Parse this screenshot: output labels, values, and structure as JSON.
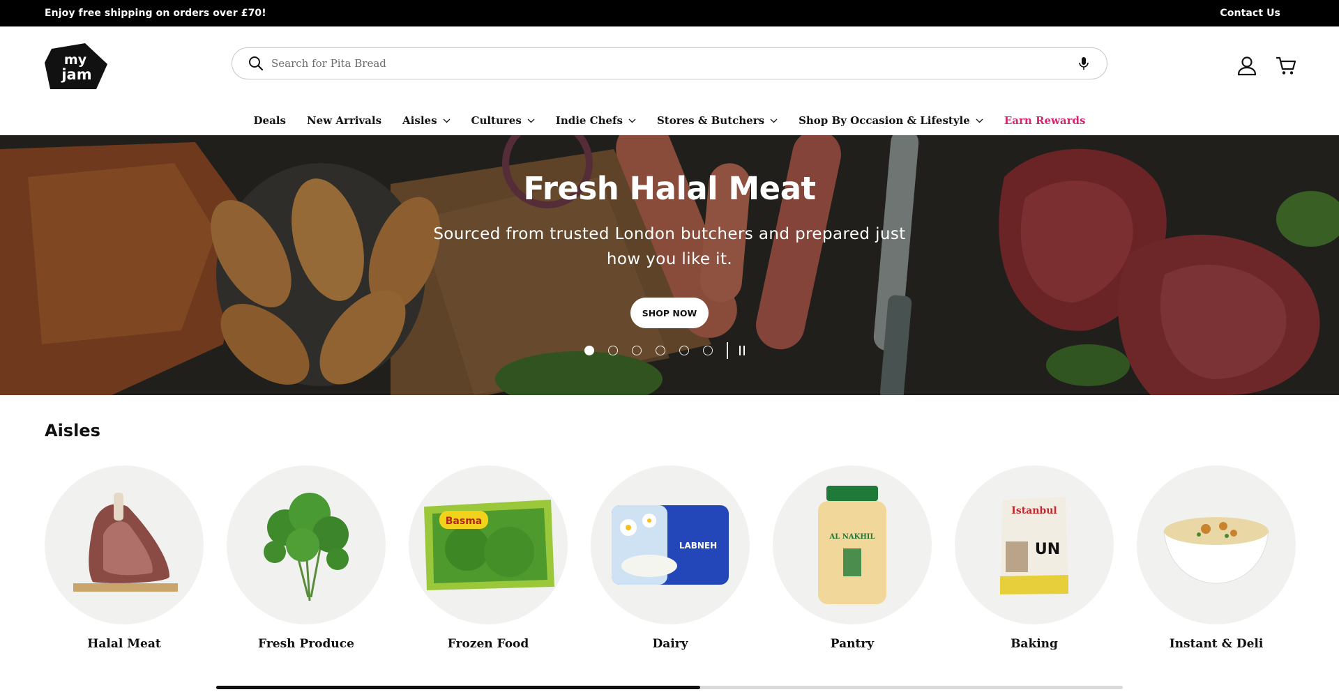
{
  "announcement": {
    "text": "Enjoy free shipping on orders over £70!",
    "contact": "Contact Us"
  },
  "logo": {
    "line1": "my",
    "line2": "jam"
  },
  "search": {
    "placeholder": "Search for Pita Bread"
  },
  "nav": [
    {
      "label": "Deals",
      "dropdown": false
    },
    {
      "label": "New Arrivals",
      "dropdown": false
    },
    {
      "label": "Aisles",
      "dropdown": true
    },
    {
      "label": "Cultures",
      "dropdown": true
    },
    {
      "label": "Indie Chefs",
      "dropdown": true
    },
    {
      "label": "Stores & Butchers",
      "dropdown": true
    },
    {
      "label": "Shop By Occasion & Lifestyle",
      "dropdown": true
    },
    {
      "label": "Earn Rewards",
      "dropdown": false
    }
  ],
  "hero": {
    "title": "Fresh Halal Meat",
    "subtitle": "Sourced from trusted London butchers and prepared just how you like it.",
    "cta": "SHOP NOW",
    "slides_total": 6,
    "active_slide": 1
  },
  "aisles": {
    "title": "Aisles",
    "items": [
      {
        "label": "Halal Meat"
      },
      {
        "label": "Fresh Produce"
      },
      {
        "label": "Frozen Food",
        "pack_text": "Basma"
      },
      {
        "label": "Dairy",
        "pack_text": "LABNEH"
      },
      {
        "label": "Pantry",
        "pack_text": "AL NAKHIL"
      },
      {
        "label": "Baking",
        "pack_text": "Istanbul",
        "pack_sub": "UN"
      },
      {
        "label": "Instant & Deli"
      }
    ],
    "scroll_position": 0.53
  },
  "colors": {
    "accent": "#d6246e",
    "announce_bg": "#000000",
    "tile_bg": "#f1f2f0"
  }
}
